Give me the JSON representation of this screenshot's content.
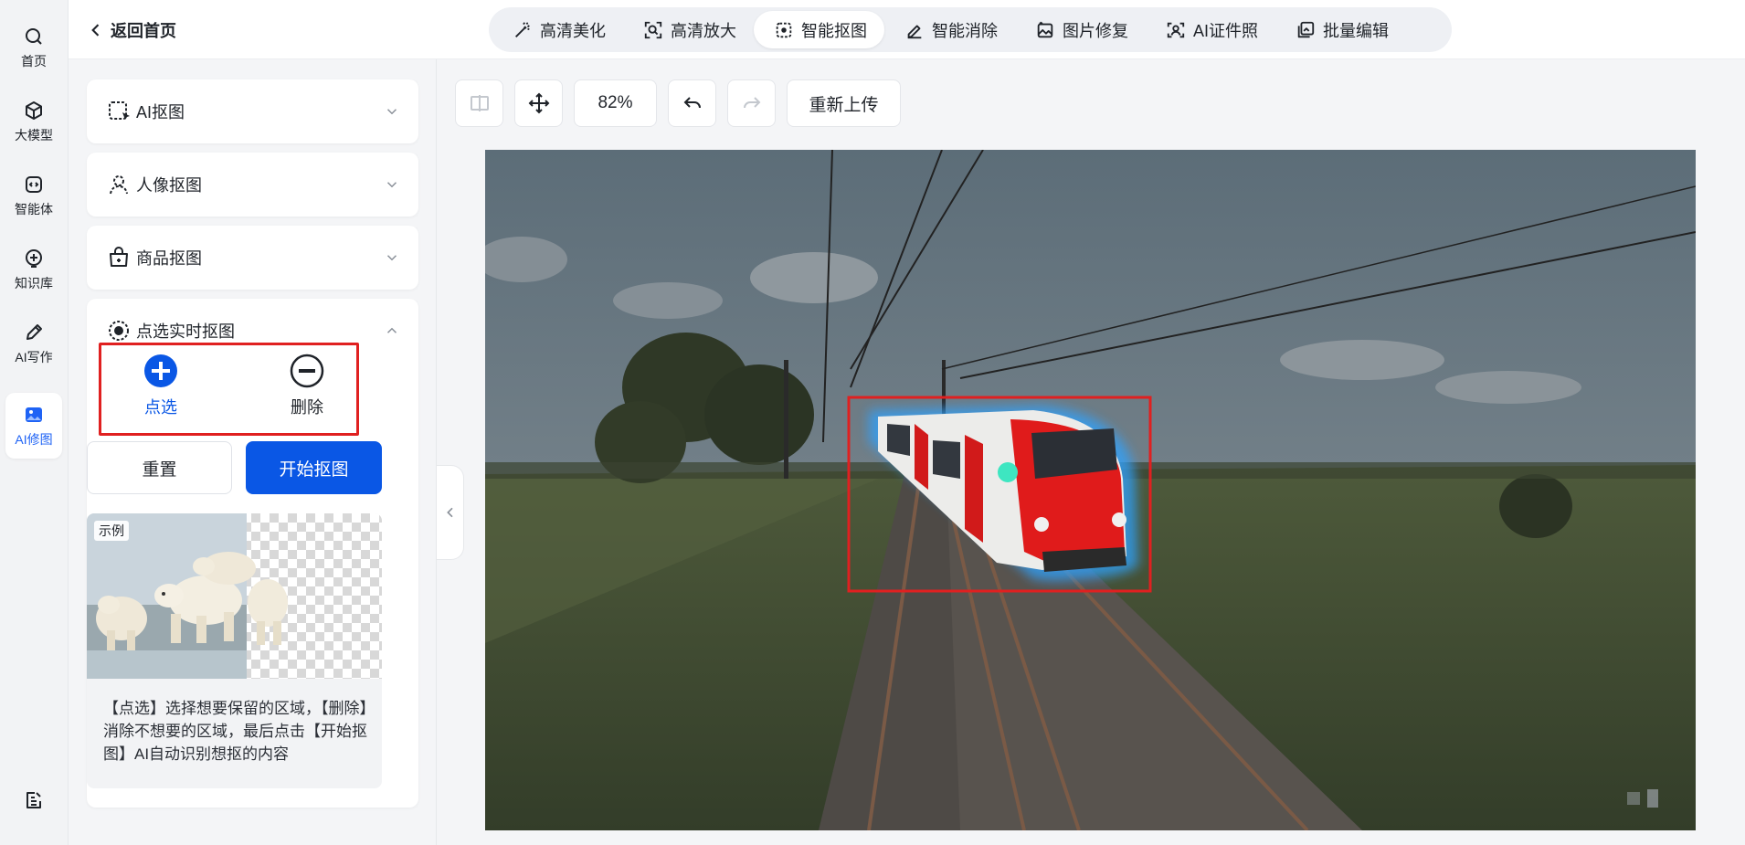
{
  "rail": {
    "items": [
      {
        "label": "首页",
        "icon": "search-icon"
      },
      {
        "label": "大模型",
        "icon": "cube-icon"
      },
      {
        "label": "智能体",
        "icon": "agent-icon"
      },
      {
        "label": "知识库",
        "icon": "knowledge-icon"
      },
      {
        "label": "AI写作",
        "icon": "pen-icon"
      },
      {
        "label": "AI修图",
        "icon": "image-icon"
      }
    ],
    "bottom_icon": "notes-icon"
  },
  "header": {
    "back_label": "返回首页",
    "tabs": [
      {
        "label": "高清美化",
        "icon": "magic-wand-icon"
      },
      {
        "label": "高清放大",
        "icon": "zoom-frame-icon"
      },
      {
        "label": "智能抠图",
        "icon": "cutout-icon",
        "active": true
      },
      {
        "label": "智能消除",
        "icon": "eraser-icon"
      },
      {
        "label": "图片修复",
        "icon": "photo-repair-icon"
      },
      {
        "label": "AI证件照",
        "icon": "id-photo-icon"
      },
      {
        "label": "批量编辑",
        "icon": "batch-edit-icon"
      }
    ]
  },
  "panel": {
    "sections": [
      {
        "label": "AI抠图",
        "icon": "ai-cutout-icon"
      },
      {
        "label": "人像抠图",
        "icon": "portrait-icon"
      },
      {
        "label": "商品抠图",
        "icon": "product-icon"
      },
      {
        "label": "点选实时抠图",
        "icon": "point-select-icon"
      }
    ],
    "modes": {
      "add_label": "点选",
      "remove_label": "删除"
    },
    "reset_label": "重置",
    "start_label": "开始抠图",
    "example_tag": "示例",
    "example_text": "【点选】选择想要保留的区域，【删除】消除不想要的区域，最后点击【开始抠图】AI自动识别想抠的内容"
  },
  "toolbar": {
    "zoom": "82%",
    "reupload_label": "重新上传"
  },
  "colors": {
    "accent": "#0a57e5",
    "highlight_box": "#e02020",
    "select_dot": "#3ee6c1"
  }
}
